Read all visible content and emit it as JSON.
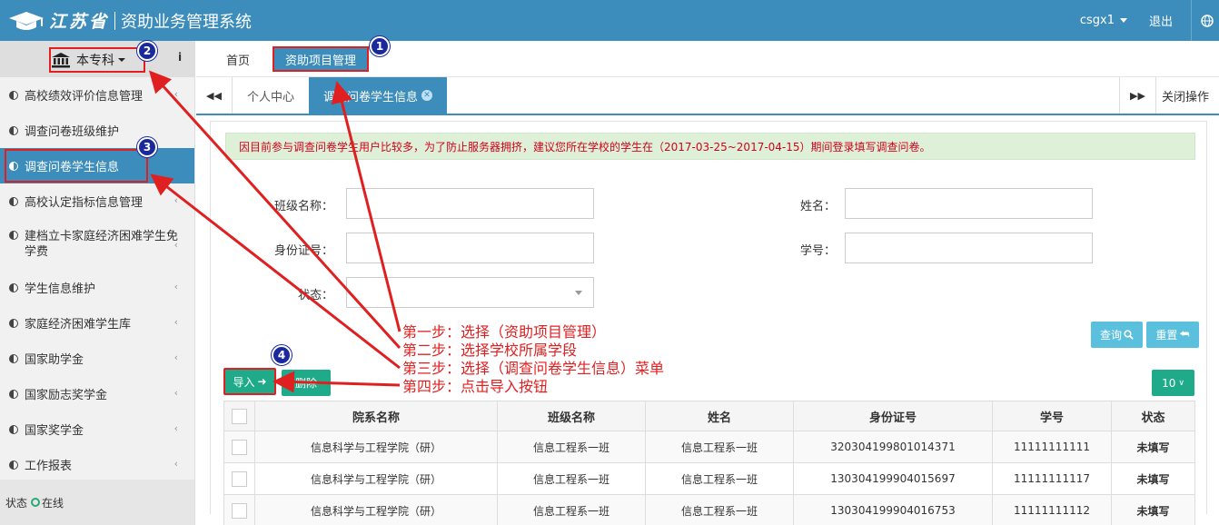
{
  "header": {
    "brand_calligraphy": "江苏省",
    "system_title": "资助业务管理系统",
    "username": "csgx1",
    "logout": "退出"
  },
  "sidebar": {
    "level_selector": "本专科",
    "info": "i",
    "items": [
      {
        "label": "高校绩效评价信息管理",
        "has_chevron": true
      },
      {
        "label": "调查问卷班级维护",
        "has_chevron": false
      },
      {
        "label": "调查问卷学生信息",
        "has_chevron": false,
        "active": true
      },
      {
        "label": "高校认定指标信息管理",
        "has_chevron": true
      },
      {
        "label": "建档立卡家庭经济困难学生免学费",
        "has_chevron": true
      },
      {
        "label": "学生信息维护",
        "has_chevron": true
      },
      {
        "label": "家庭经济困难学生库",
        "has_chevron": true
      },
      {
        "label": "国家助学金",
        "has_chevron": true
      },
      {
        "label": "国家励志奖学金",
        "has_chevron": true
      },
      {
        "label": "国家奖学金",
        "has_chevron": true
      },
      {
        "label": "工作报表",
        "has_chevron": true
      }
    ],
    "status_label": "状态",
    "status_value": "在线"
  },
  "topnav": {
    "home": "首页",
    "project": "资助项目管理"
  },
  "pagetabs": {
    "personal": "个人中心",
    "current": "调查问卷学生信息",
    "close_ops": "关闭操作"
  },
  "notice": "因目前参与调查问卷学生用户比较多，为了防止服务器拥挤，建议您所在学校的学生在（2017-03-25~2017-04-15）期间登录填写调查问卷。",
  "form": {
    "class_label": "班级名称：",
    "name_label": "姓名：",
    "id_label": "身份证号：",
    "student_no_label": "学号：",
    "status_label": "状态：",
    "class_value": "",
    "name_value": "",
    "id_value": "",
    "student_no_value": "",
    "status_value": ""
  },
  "buttons": {
    "query": "查询",
    "reset": "重置",
    "import": "导入",
    "delete": "删除",
    "page_size": "10"
  },
  "table": {
    "headers": [
      "院系名称",
      "班级名称",
      "姓名",
      "身份证号",
      "学号",
      "状态"
    ],
    "rows": [
      [
        "信息科学与工程学院（研）",
        "信息工程系一班",
        "信息工程系一班",
        "320304199801014371",
        "11111111111",
        "未填写"
      ],
      [
        "信息科学与工程学院（研）",
        "信息工程系一班",
        "信息工程系一班",
        "130304199904015697",
        "11111111117",
        "未填写"
      ],
      [
        "信息科学与工程学院（研）",
        "信息工程系一班",
        "信息工程系一班",
        "130304199904016753",
        "11111111112",
        "未填写"
      ]
    ]
  },
  "annotations": {
    "steps": [
      "第一步：选择（资助项目管理）",
      "第二步：选择学校所属学段",
      "第三步：选择（调查问卷学生信息）菜单",
      "第四步：点击导入按钮"
    ],
    "badges": [
      "1",
      "2",
      "3",
      "4"
    ],
    "color": "#e02020"
  },
  "colors": {
    "header": "#3c8dbc",
    "notice_bg": "#dff0d8",
    "notice_text": "#d0021b",
    "teal": "#1fab89",
    "info_btn": "#5bc0de"
  }
}
